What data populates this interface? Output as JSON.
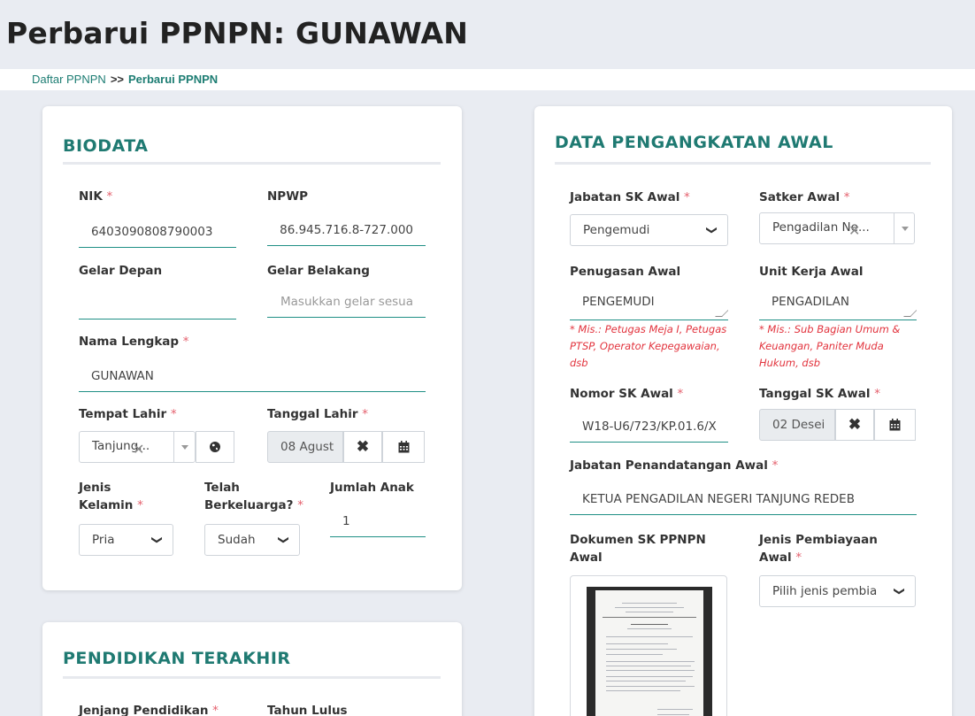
{
  "page": {
    "title": "Perbarui PPNPN: GUNAWAN"
  },
  "breadcrumb": {
    "link": "Daftar PPNPN",
    "separator": ">>",
    "current": "Perbarui PPNPN"
  },
  "biodata": {
    "title": "BIODATA",
    "nik": {
      "label": "NIK",
      "value": "6403090808790003"
    },
    "npwp": {
      "label": "NPWP",
      "value": "86.945.716.8-727.000"
    },
    "gelar_depan": {
      "label": "Gelar Depan",
      "value": ""
    },
    "gelar_belakang": {
      "label": "Gelar Belakang",
      "placeholder": "Masukkan gelar sesua"
    },
    "nama_lengkap": {
      "label": "Nama Lengkap",
      "value": "GUNAWAN"
    },
    "tempat_lahir": {
      "label": "Tempat Lahir",
      "value": "Tanjung..."
    },
    "tanggal_lahir": {
      "label": "Tanggal Lahir",
      "value": "08 Agust"
    },
    "jenis_kelamin": {
      "label_line1": "Jenis",
      "label_line2": "Kelamin",
      "value": "Pria"
    },
    "telah_berkeluarga": {
      "label_line1": "Telah",
      "label_line2": "Berkeluarga?",
      "value": "Sudah"
    },
    "jumlah_anak": {
      "label": "Jumlah Anak",
      "value": "1"
    }
  },
  "pendidikan": {
    "title": "PENDIDIKAN TERAKHIR",
    "jenjang_label": "Jenjang Pendidikan",
    "tahun_label": "Tahun Lulus"
  },
  "pengangkatan": {
    "title": "DATA PENGANGKATAN AWAL",
    "jabatan_sk": {
      "label": "Jabatan SK Awal",
      "value": "Pengemudi"
    },
    "satker": {
      "label": "Satker Awal",
      "value": "Pengadilan Ne..."
    },
    "penugasan": {
      "label": "Penugasan Awal",
      "value": "PENGEMUDI",
      "note": [
        "* Mis.: Petugas Meja I, Petugas",
        "PTSP, Operator Kepegawaian,",
        "dsb"
      ]
    },
    "unit_kerja": {
      "label": "Unit Kerja Awal",
      "value": "PENGADILAN",
      "note": [
        "* Mis.: Sub Bagian Umum &",
        "Keuangan, Paniter Muda",
        "Hukum, dsb"
      ]
    },
    "nomor_sk": {
      "label": "Nomor SK Awal",
      "value": "W18-U6/723/KP.01.6/X"
    },
    "tanggal_sk": {
      "label": "Tanggal SK Awal",
      "value": "02 Desei"
    },
    "jabatan_penandatangan": {
      "label": "Jabatan Penandatangan Awal",
      "value": "KETUA PENGADILAN NEGERI TANJUNG REDEB"
    },
    "dokumen_sk": {
      "label_line1": "Dokumen SK PPNPN",
      "label_line2": "Awal"
    },
    "jenis_pembiayaan": {
      "label_line1": "Jenis Pembiayaan",
      "label_line2": "Awal",
      "placeholder": "Pilih jenis pembia"
    }
  },
  "required_marker": "*",
  "icons": {
    "chevron": "chevron-down-icon",
    "globe": "globe-icon",
    "clear": "close-icon",
    "calendar": "calendar-icon"
  }
}
